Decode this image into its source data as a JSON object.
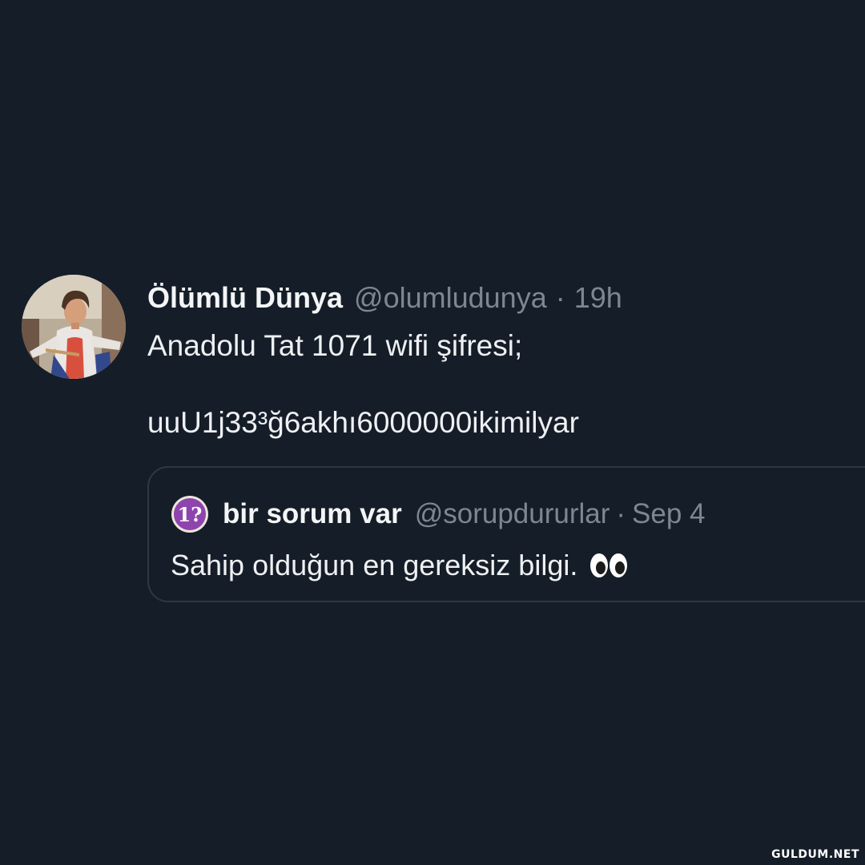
{
  "tweet": {
    "display_name": "Ölümlü Dünya",
    "handle": "@olumludunya",
    "separator": "·",
    "time": "19h",
    "text": "Anadolu Tat 1071 wifi şifresi;\n\nuuU1j33³ğ6akhı6000000ikimilyar",
    "avatar_icon": "user-avatar-photo"
  },
  "quoted_tweet": {
    "avatar_icon": "question-exclamation-avatar",
    "display_name": "bir sorum var",
    "handle": "@sorupdururlar",
    "separator": "·",
    "time": "Sep 4",
    "text": "Sahip olduğun en gereksiz bilgi.",
    "emoji_icon": "eyes-emoji"
  },
  "watermark": "GULDUM.NET",
  "colors": {
    "background": "#151d28",
    "secondary_text": "#7d8791",
    "quote_border": "#2d3843",
    "quote_avatar": "#8e44ad"
  }
}
